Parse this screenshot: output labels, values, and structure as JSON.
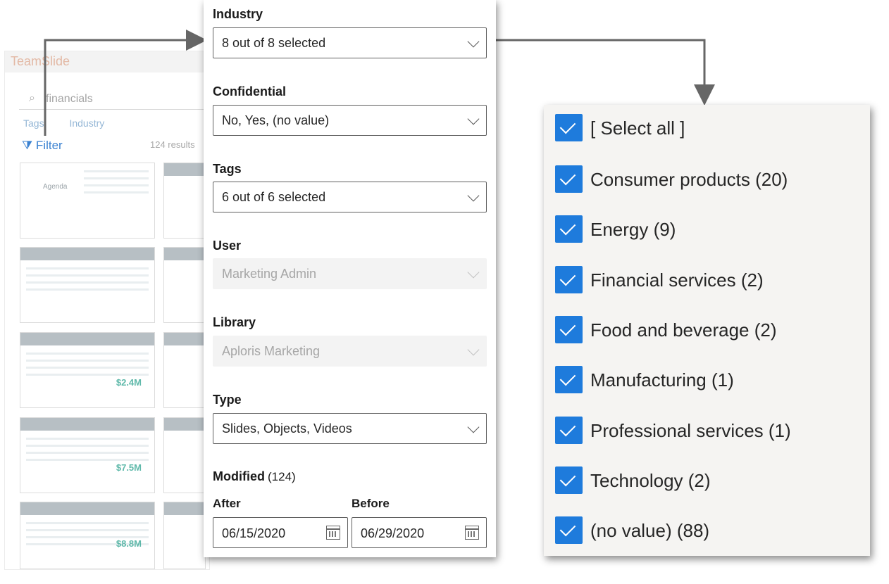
{
  "background_app": {
    "title": "TeamSlide",
    "search_value": "financials",
    "tabs": [
      "Tags",
      "Industry"
    ],
    "filter_label": "Filter",
    "results_text": "124 results",
    "thumbs": {
      "agenda": "Agenda",
      "t1": "$2.4M",
      "t2": "$7.5M",
      "t3": "$8.8M"
    }
  },
  "filter_panel": {
    "industry": {
      "label": "Industry",
      "value": "8 out of 8 selected"
    },
    "confidential": {
      "label": "Confidential",
      "value": "No, Yes, (no value)"
    },
    "tags": {
      "label": "Tags",
      "value": "6 out of 6 selected"
    },
    "user": {
      "label": "User",
      "value": "Marketing Admin"
    },
    "library": {
      "label": "Library",
      "value": "Aploris Marketing"
    },
    "type": {
      "label": "Type",
      "value": "Slides, Objects, Videos"
    },
    "modified": {
      "label": "Modified",
      "count": "(124)",
      "after_label": "After",
      "after_value": "06/15/2020",
      "before_label": "Before",
      "before_value": "06/29/2020"
    }
  },
  "industry_options": [
    {
      "label": "[ Select all ]",
      "checked": true
    },
    {
      "label": "Consumer products (20)",
      "checked": true
    },
    {
      "label": "Energy (9)",
      "checked": true
    },
    {
      "label": "Financial services (2)",
      "checked": true
    },
    {
      "label": "Food and beverage (2)",
      "checked": true
    },
    {
      "label": "Manufacturing (1)",
      "checked": true
    },
    {
      "label": "Professional services (1)",
      "checked": true
    },
    {
      "label": "Technology (2)",
      "checked": true
    },
    {
      "label": "(no value) (88)",
      "checked": true
    }
  ],
  "colors": {
    "accent": "#1e7bdc",
    "arrow": "#666666"
  }
}
